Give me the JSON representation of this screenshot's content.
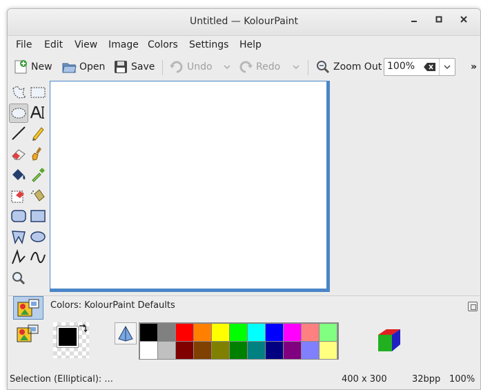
{
  "window": {
    "title": "Untitled — KolourPaint"
  },
  "menubar": {
    "items": [
      "File",
      "Edit",
      "View",
      "Image",
      "Colors",
      "Settings",
      "Help"
    ]
  },
  "toolbar": {
    "new_label": "New",
    "open_label": "Open",
    "save_label": "Save",
    "undo_label": "Undo",
    "redo_label": "Redo",
    "zoom_out_label": "Zoom Out",
    "zoom_value": "100%",
    "overflow": "»"
  },
  "colors_panel": {
    "title": "Colors: KolourPaint Defaults",
    "palette_top": [
      "#000000",
      "#808080",
      "#ff0000",
      "#ff8000",
      "#ffff00",
      "#00ff00",
      "#00ffff",
      "#0000ff",
      "#ff00ff",
      "#ff8080",
      "#80ff80"
    ],
    "palette_bottom": [
      "#ffffff",
      "#c0c0c0",
      "#800000",
      "#804000",
      "#808000",
      "#008000",
      "#008080",
      "#000080",
      "#800080",
      "#8080ff",
      "#ffff80"
    ],
    "foreground": "#000000",
    "background": "#ffffff"
  },
  "statusbar": {
    "tool_text": "Selection (Elliptical): ...",
    "size_text": "400 x 300",
    "depth_text": "32bpp",
    "zoom_text": "100%"
  },
  "colors": {
    "accent": "#4a86c8"
  }
}
